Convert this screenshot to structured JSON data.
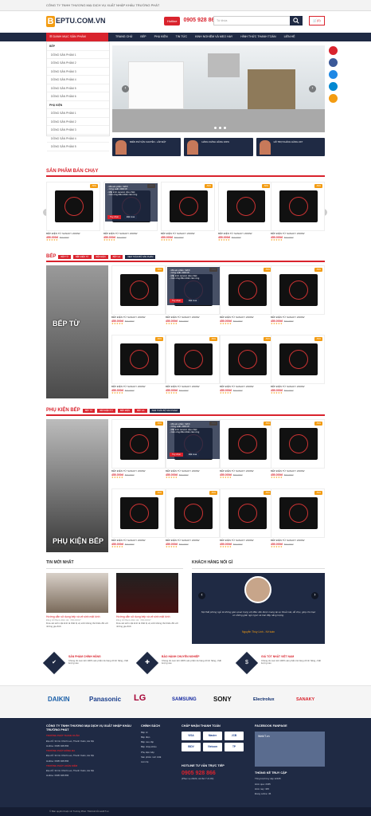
{
  "topbar": {
    "company": "CÔNG TY TNHH THƯƠNG MẠI DỊCH VỤ XUẤT NHẬP KHẨU TRƯỜNG PHÁT"
  },
  "header": {
    "logo_letter": "B",
    "logo_text": "EPTU.COM.VN",
    "hotline_label": "Hotline",
    "hotline_number": "0905 928 866",
    "search_placeholder": "Từ khóa",
    "cart_label": "(0)"
  },
  "nav": {
    "category_label": "DANH MỤC SẢN PHẨM",
    "items": [
      "TRANG CHỦ",
      "BẾP",
      "PHỤ KIỆN",
      "TIN TỨC",
      "KINH NGHIỆM VÀ MẸO HAY",
      "HÌNH THỨC THANH TOÁN",
      "LIÊN HỆ"
    ]
  },
  "sidebar": {
    "group1": "BẾP",
    "group1_items": [
      "DÒNG SẢN PHẨM 1",
      "DÒNG SẢN PHẨM 2",
      "DÒNG SẢN PHẨM 3",
      "DÒNG SẢN PHẨM 4",
      "DÒNG SẢN PHẨM 5",
      "DÒNG SẢN PHẨM 6"
    ],
    "group2": "PHỤ KIỆN",
    "group2_items": [
      "DÒNG SẢN PHẨM 1",
      "DÒNG SẢN PHẨM 2",
      "DÒNG SẢN PHẨM 3",
      "DÒNG SẢN PHẨM 4",
      "DÒNG SẢN PHẨM 5",
      "DÒNG SẢN PHẨM 6"
    ]
  },
  "banners": [
    "MIỄN PHÍ VẬN CHUYỂN - LẮP ĐẶT",
    "HÀNG CHÍNH HÃNG 100%",
    "HỖ TRỢ KHÁCH HÀNG 24/7"
  ],
  "product": {
    "name": "BẾP ĐIỆN TỪ SANAKY 2000W",
    "price": "450.000đ",
    "old_price": "890.000đ",
    "sale": "-50%",
    "stars": "★★★★★",
    "popup_lines": [
      "- Mã sản phẩm: 92F9",
      "- Công suất: 2000 W",
      "- Mặt kính ceramic chịu nhiệt",
      "- Cảm ứng điều khiển cảm ứng"
    ],
    "buy_label": "Tùy chọn",
    "detail_label": "Đặt mua"
  },
  "sections": {
    "best": "SẢN PHẨM BÁN CHẠY",
    "stove": "BẾP",
    "stove_tags": [
      "BẾP TỪ",
      "BẾP ĐIỆN TỪ",
      "BẾP ĐIỆN",
      "BẾP GA",
      "XEM TOÀN BỘ SẢN PHẨM"
    ],
    "stove_image_label": "BẾP TỪ",
    "acc": "PHỤ KIỆN BẾP",
    "acc_tags": [
      "BẾP TỪ",
      "BẾP ĐIỆN TỪ",
      "BẾP ĐIỆN",
      "BẾP GA",
      "XEM TOÀN BỘ SẢN PHẨM"
    ],
    "acc_image_label": "PHỤ KIỆN BẾP",
    "news": "TIN MỚI NHẤT",
    "testimonial": "KHÁCH HÀNG NÓI GÌ"
  },
  "news": [
    {
      "title": "Hướng dẫn sử dụng bếp và vệ sinh mặt kính",
      "meta": "Đăng bởi Beptu Điện Hà · 06/12/2017",
      "desc": "Dưa vài sinh mặt kính là thiết bị vệ sinh không thể thiếu đối với những gia đình"
    },
    {
      "title": "Hướng dẫn sử dụng bếp và vệ sinh mặt kính",
      "meta": "Đăng bởi Beptu Điện Hà · 06/12/2017",
      "desc": "Dưa vài sinh mặt kính là thiết bị vệ sinh không thể thiếu đối với những gia đình"
    }
  ],
  "testimonial": {
    "quote": "Nội thất phòng ngủ là không gian quan trọng với điều cần được mang lại sự thoải mái, dễ chịu, giúp cho bạn có những giấc ngủ ngon và tràn đầy năng lượng.",
    "name": "Nguyễn Thùy Linh - Kế toán"
  },
  "services": [
    {
      "title": "SẢN PHẨM CHÍNH HÃNG",
      "desc": "Chúng tôi cam kết 100% sản phẩm là hàng chính hãng, chất lượng cao"
    },
    {
      "title": "BẢO HÀNH CHUYÊN NGHIỆP",
      "desc": "Chúng tôi cam kết 100% sản phẩm là hàng chính hãng, chất lượng cao"
    },
    {
      "title": "GIÁ TỐT NHẤT VIỆT NAM",
      "desc": "Chúng tôi cam kết 100% sản phẩm là hàng chính hãng, chất lượng cao"
    }
  ],
  "brands": [
    "DAIKIN",
    "Panasonic",
    "LG",
    "SAMSUNG",
    "SONY",
    "Electrolux",
    "SANAKY"
  ],
  "footer": {
    "company": "CÔNG TY TNHH THƯƠNG MẠI DỊCH VỤ XUẤT NHẬP KHẨU TRƯỜNG PHÁT",
    "branches": [
      {
        "name": "TRƯỜNG PHÁT THANH XUÂN",
        "addr": "Địa chỉ: 34 Cù Chính Lan, Thanh Xuân, Hà Nội",
        "phone": "Hotline: 0905 928 866"
      },
      {
        "name": "TRƯỜNG PHÁT ĐỐNG ĐA",
        "addr": "Địa chỉ: 34 Cù Chính Lan, Thanh Xuân, Hà Nội",
        "phone": "Hotline: 0905 928 866"
      },
      {
        "name": "TRƯỜNG PHÁT HOÀN KIẾM",
        "addr": "Địa chỉ: 34 Cù Chính Lan, Thanh Xuân, Hà Nội",
        "phone": "Hotline: 0905 928 866"
      }
    ],
    "policy_title": "CHÍNH SÁCH",
    "policy_items": [
      "Bếp từ",
      "Bếp điện",
      "Bếp cao cấp",
      "Bếp nhập khẩu",
      "Phụ kiện bếp",
      "Sản phẩm mới nhất",
      "Liên hệ"
    ],
    "pay_title": "CHẤP NHẬN THANH TOÁN",
    "pay": [
      "VISA",
      "Master",
      "JCB",
      "BIDV",
      "Vietcom",
      "TP"
    ],
    "hotline_title": "HOTLINE TƯ VẤN TRỰC TIẾP",
    "hotline_num": "0905 928 866",
    "hotline_note": "(Phục vụ 24/24, cả thứ 7 & CN)",
    "fb_title": "FACEBOOK FANPAGE",
    "fb_text": "WebIT.vn",
    "stats_title": "THỐNG KÊ TRUY CẬP",
    "stats": [
      [
        "Tổng lượt truy cập",
        "12345"
      ],
      [
        "Hôm qua:",
        "2345"
      ],
      [
        "Hôm nay:",
        "345"
      ],
      [
        "Đang online:",
        "45"
      ]
    ],
    "copyright": "© Bản quyền thuộc về Trường Phát. Thiết kế bởi webIT.vn"
  }
}
